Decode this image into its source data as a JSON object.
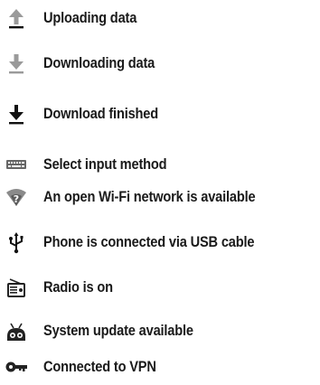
{
  "notifications": [
    {
      "label": "Uploading data",
      "icon": "upload-icon"
    },
    {
      "label": "Downloading data",
      "icon": "download-icon"
    },
    {
      "label": "Download finished",
      "icon": "download-done-icon"
    },
    {
      "label": "Select input method",
      "icon": "keyboard-icon"
    },
    {
      "label": "An open Wi-Fi network is available",
      "icon": "wifi-open-icon"
    },
    {
      "label": "Phone is connected via USB cable",
      "icon": "usb-icon"
    },
    {
      "label": "Radio is on",
      "icon": "radio-icon"
    },
    {
      "label": "System update available",
      "icon": "system-update-icon"
    },
    {
      "label": "Connected to VPN",
      "icon": "vpn-key-icon"
    }
  ]
}
